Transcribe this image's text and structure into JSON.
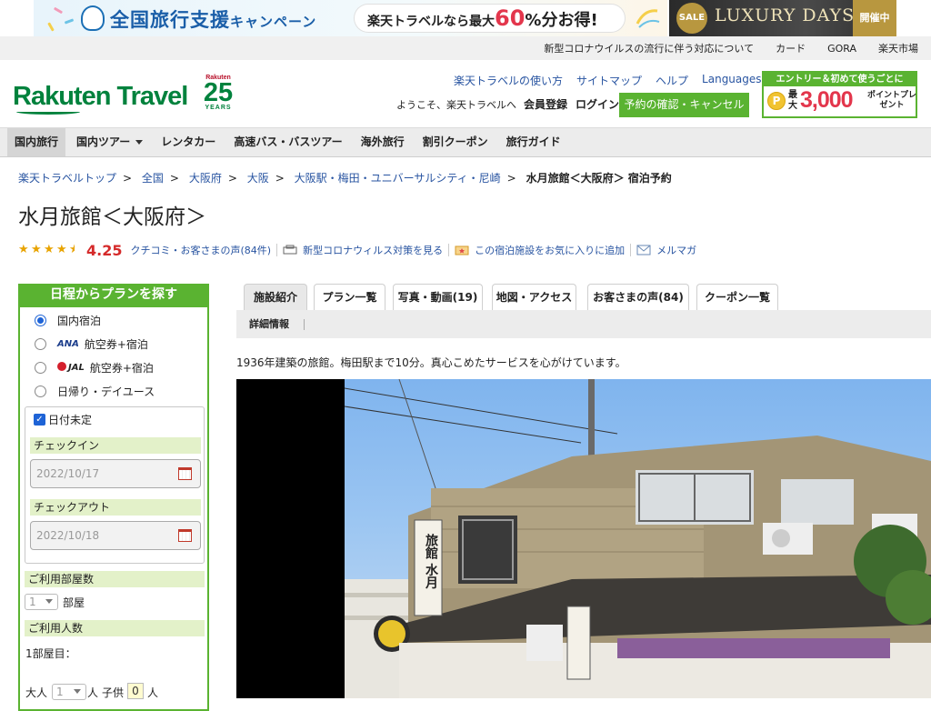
{
  "banner": {
    "campaign_title": "全国旅行支援",
    "campaign_suffix": "キャンペーン",
    "pill_prefix": "楽天トラベルなら最大",
    "pill_percent": "60",
    "pill_suffix": "%分お得!",
    "sale_badge": "SALE",
    "luxury_text": "LUXURY DAYS",
    "luxury_status": "開催中"
  },
  "utility_nav": [
    "新型コロナウイルスの流行に伴う対応について",
    "カード",
    "GORA",
    "楽天市場"
  ],
  "header": {
    "logo": "Rakuten Travel",
    "anniv_brand": "Rakuten",
    "anniv_number": "25",
    "anniv_label": "YEARS",
    "links": [
      "楽天トラベルの使い方",
      "サイトマップ",
      "ヘルプ",
      "Languages"
    ],
    "welcome": "ようこそ、楽天トラベルへ",
    "register": "会員登録",
    "login": "ログイン",
    "confirm_button": "予約の確認・キャンセル",
    "promo_top": "エントリー＆初めて使うごとに",
    "promo_coin": "P",
    "promo_max": "最大",
    "promo_amount": "3,000",
    "promo_sub": "ポイントプレゼント"
  },
  "main_nav": [
    "国内旅行",
    "国内ツアー",
    "レンタカー",
    "高速バス・バスツアー",
    "海外旅行",
    "割引クーポン",
    "旅行ガイド"
  ],
  "breadcrumb": {
    "items": [
      "楽天トラベルトップ",
      "全国",
      "大阪府",
      "大阪",
      "大阪駅・梅田・ユニバーサルシティ・尼崎"
    ],
    "current": "水月旅館＜大阪府＞ 宿泊予約",
    "separator": ">"
  },
  "hotel": {
    "name": "水月旅館＜大阪府＞",
    "rating": 4.25,
    "rating_text": "4.25",
    "review_link": "クチコミ・お客さまの声(84件)",
    "covid_link": "新型コロナウィルス対策を見る",
    "favorite_link": "この宿泊施設をお気に入りに追加",
    "mail_link": "メルマガ",
    "catch_copy": "1936年建築の旅館。梅田駅まで10分。真心こめたサービスを心がけています。",
    "sign_text": "旅館 水月"
  },
  "search_panel": {
    "title": "日程からプランを探す",
    "options": [
      {
        "label": "国内宿泊",
        "selected": true
      },
      {
        "airline": "ANA",
        "label": "航空券+宿泊",
        "selected": false
      },
      {
        "airline": "JAL",
        "label": "航空券+宿泊",
        "selected": false
      },
      {
        "label": "日帰り・デイユース",
        "selected": false
      }
    ],
    "date_undecided": "日付未定",
    "checkin_label": "チェックイン",
    "checkin_value": "2022/10/17",
    "checkout_label": "チェックアウト",
    "checkout_value": "2022/10/18",
    "rooms_label": "ご利用部屋数",
    "rooms_value": "1",
    "rooms_unit": "部屋",
    "guests_label": "ご利用人数",
    "room1_label": "1部屋目：",
    "adult_label": "大人",
    "adult_value": "1",
    "person_unit": "人",
    "child_label": "子供",
    "child_value": "0"
  },
  "tabs": [
    "施設紹介",
    "プラン一覧",
    "写真・動画(19)",
    "地図・アクセス",
    "お客さまの声(84)",
    "クーポン一覧"
  ],
  "subtab": "詳細情報",
  "colors": {
    "brand_green": "#00823d",
    "button_green": "#5ab331",
    "link_blue": "#2854a1",
    "score_red": "#d52a2a"
  }
}
